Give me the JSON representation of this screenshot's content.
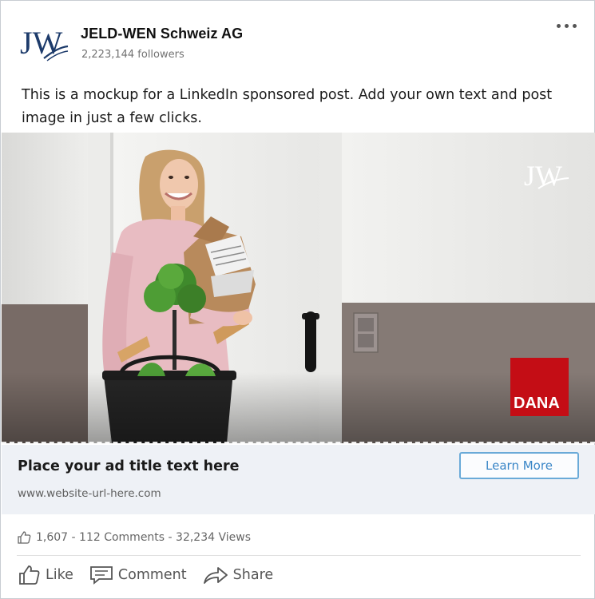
{
  "post": {
    "company_name": "JELD-WEN Schweiz AG",
    "followers": "2,223,144 followers",
    "logo_text": "JW",
    "text": "This is a mockup for a LinkedIn sponsored post. Add your own text and post image in just a few clicks."
  },
  "image": {
    "watermark_logo": "JW",
    "badge_brand": "DANA",
    "badge_color": "#c40d15"
  },
  "ad": {
    "title": "Place your ad title text here",
    "url": "www.website-url-here.com",
    "cta_label": "Learn More"
  },
  "stats": {
    "text": "1,607 - 112 Comments - 32,234 Views"
  },
  "actions": {
    "like_label": "Like",
    "comment_label": "Comment",
    "share_label": "Share"
  },
  "colors": {
    "brand_navy": "#1d3b6b",
    "cta_blue": "#3a86c7",
    "ad_bar_bg": "#eef1f6"
  }
}
